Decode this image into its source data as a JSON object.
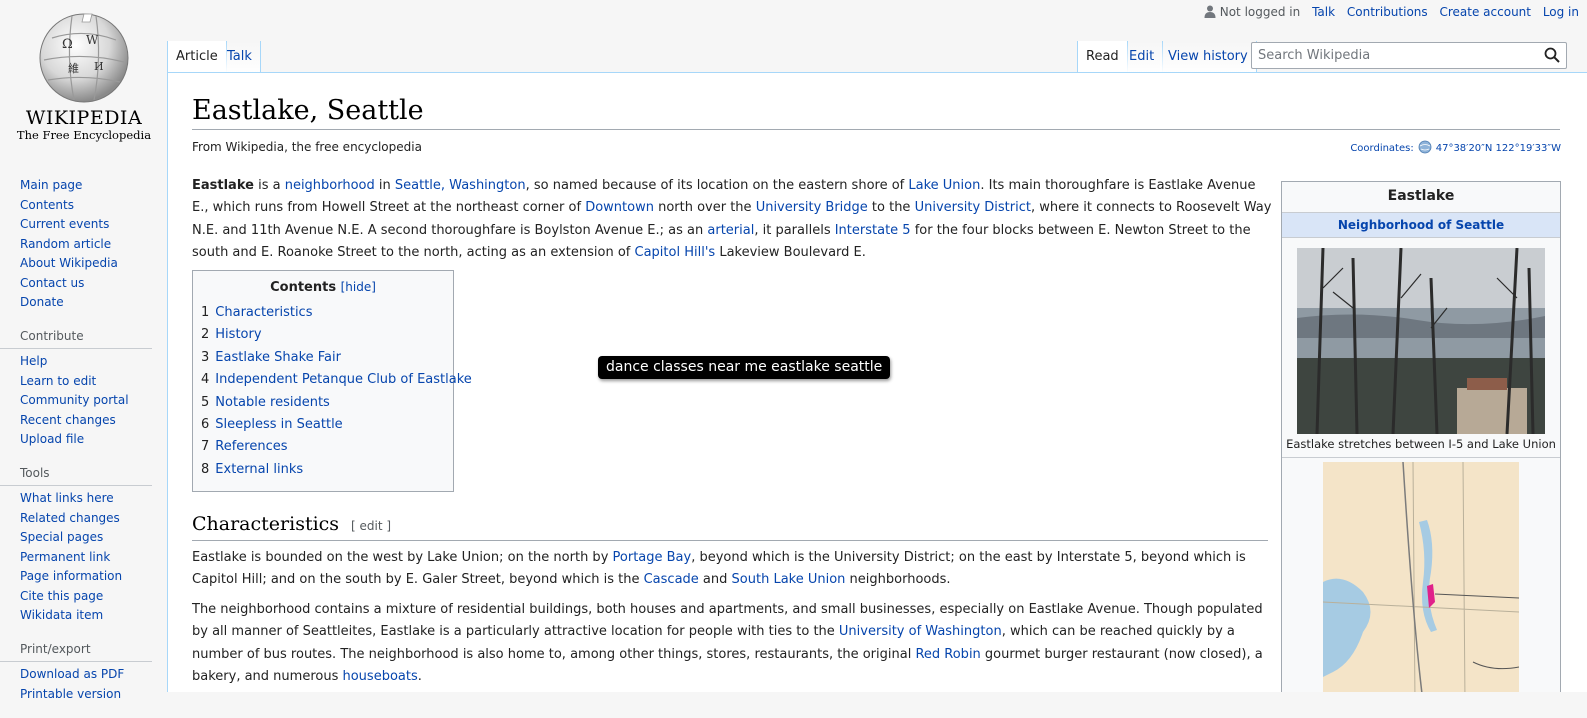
{
  "logo": {
    "wordmark": "WIKIPEDIA",
    "tagline": "The Free Encyclopedia"
  },
  "personal": {
    "not_logged_in": "Not logged in",
    "talk": "Talk",
    "contributions": "Contributions",
    "create_account": "Create account",
    "log_in": "Log in"
  },
  "tabs": {
    "article": "Article",
    "talk": "Talk",
    "read": "Read",
    "edit": "Edit",
    "view_history": "View history"
  },
  "search": {
    "placeholder": "Search Wikipedia"
  },
  "sidebar": {
    "navigation": [
      "Main page",
      "Contents",
      "Current events",
      "Random article",
      "About Wikipedia",
      "Contact us",
      "Donate"
    ],
    "contribute_heading": "Contribute",
    "contribute": [
      "Help",
      "Learn to edit",
      "Community portal",
      "Recent changes",
      "Upload file"
    ],
    "tools_heading": "Tools",
    "tools": [
      "What links here",
      "Related changes",
      "Special pages",
      "Permanent link",
      "Page information",
      "Cite this page",
      "Wikidata item"
    ],
    "print_heading": "Print/export",
    "print": [
      "Download as PDF",
      "Printable version"
    ]
  },
  "article": {
    "title": "Eastlake, Seattle",
    "subtitle": "From Wikipedia, the free encyclopedia",
    "coords_label": "Coordinates:",
    "coords_value": "47°38′20″N 122°19′33″W",
    "p1": {
      "b": "Eastlake",
      "t1": " is a ",
      "l1": "neighborhood",
      "t2": " in ",
      "l2": "Seattle, Washington",
      "t3": ", so named because of its location on the eastern shore of ",
      "l3": "Lake Union",
      "t4": ". Its main thoroughfare is Eastlake Avenue E., which runs from Howell Street at the northeast corner of ",
      "l4": "Downtown",
      "t5": " north over the ",
      "l5": "University Bridge",
      "t6": " to the ",
      "l6": "University District",
      "t7": ", where it connects to Roosevelt Way N.E. and 11th Avenue N.E. A second thoroughfare is Boylston Avenue E.; as an ",
      "l7": "arterial",
      "t8": ", it parallels ",
      "l8": "Interstate 5",
      "t9": " for the four blocks between E. Newton Street to the south and E. Roanoke Street to the north, acting as an extension of ",
      "l9": "Capitol Hill's",
      "t10": " Lakeview Boulevard E."
    },
    "toc": {
      "title": "Contents",
      "hide": "[hide]",
      "items": [
        {
          "num": "1",
          "label": "Characteristics"
        },
        {
          "num": "2",
          "label": "History"
        },
        {
          "num": "3",
          "label": "Eastlake Shake Fair"
        },
        {
          "num": "4",
          "label": "Independent Petanque Club of Eastlake"
        },
        {
          "num": "5",
          "label": "Notable residents"
        },
        {
          "num": "6",
          "label": "Sleepless in Seattle"
        },
        {
          "num": "7",
          "label": "References"
        },
        {
          "num": "8",
          "label": "External links"
        }
      ]
    },
    "tooltip": "dance classes near me eastlake seattle",
    "section1": {
      "heading": "Characteristics",
      "edit": "[ edit ]"
    },
    "p2": {
      "t1": "Eastlake is bounded on the west by Lake Union; on the north by ",
      "l1": "Portage Bay",
      "t2": ", beyond which is the University District; on the east by Interstate 5, beyond which is Capitol Hill; and on the south by E. Galer Street, beyond which is the ",
      "l2": "Cascade",
      "t3": " and ",
      "l3": "South Lake Union",
      "t4": " neighborhoods."
    },
    "p3": {
      "t1": "The neighborhood contains a mixture of residential buildings, both houses and apartments, and small businesses, especially on Eastlake Avenue. Though populated by all manner of Seattleites, Eastlake is a particularly attractive location for people with ties to the ",
      "l1": "University of Washington",
      "t2": ", which can be reached quickly by a number of bus routes. The neighborhood is also home to, among other things, stores, restaurants, the original ",
      "l2": "Red Robin",
      "t3": " gourmet burger restaurant (now closed), a bakery, and numerous ",
      "l3": "houseboats",
      "t4": "."
    }
  },
  "infobox": {
    "title": "Eastlake",
    "subtitle": "Neighborhood of Seattle",
    "caption": "Eastlake stretches between I-5 and Lake Union"
  },
  "colors": {
    "link": "#0645ad",
    "border": "#a7d7f9",
    "infobox_sub": "#d9e5f7",
    "map_highlight": "#e0218a"
  }
}
